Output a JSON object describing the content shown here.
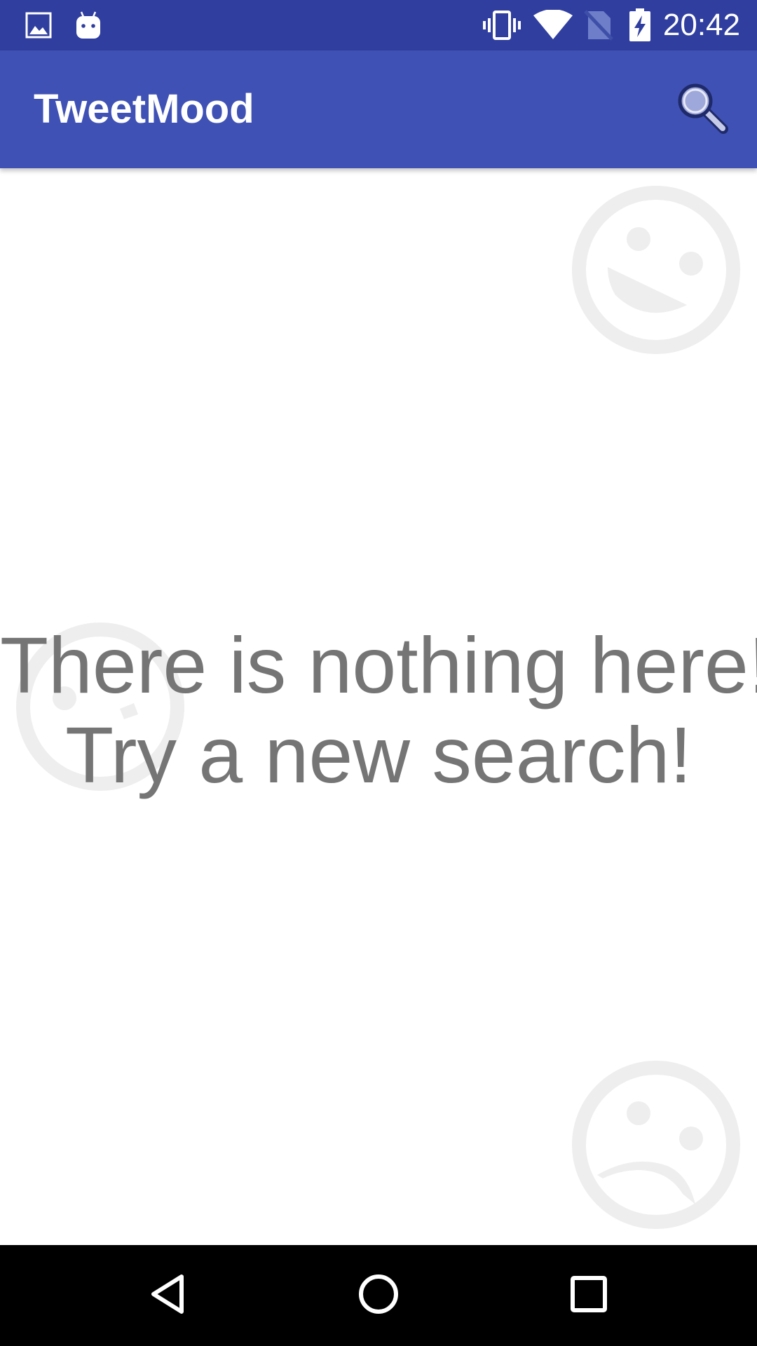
{
  "status_bar": {
    "time": "20:42",
    "left_icons": [
      "image-notification-icon",
      "android-notification-icon"
    ],
    "right_icons": [
      "vibrate-icon",
      "wifi-icon",
      "no-sim-icon",
      "battery-charging-icon"
    ],
    "background_color": "#303f9f"
  },
  "app_bar": {
    "title": "TweetMood",
    "action_icon": "search-icon",
    "background_color": "#3f51b5"
  },
  "empty_state": {
    "line1": "There is nothing here!",
    "line2": "Try a new search!",
    "text_color": "#757575",
    "background_icons": [
      "happy-face-icon",
      "neutral-face-icon",
      "sad-face-icon"
    ]
  },
  "nav_bar": {
    "buttons": [
      "back-icon",
      "home-icon",
      "recents-icon"
    ],
    "background_color": "#000000"
  }
}
